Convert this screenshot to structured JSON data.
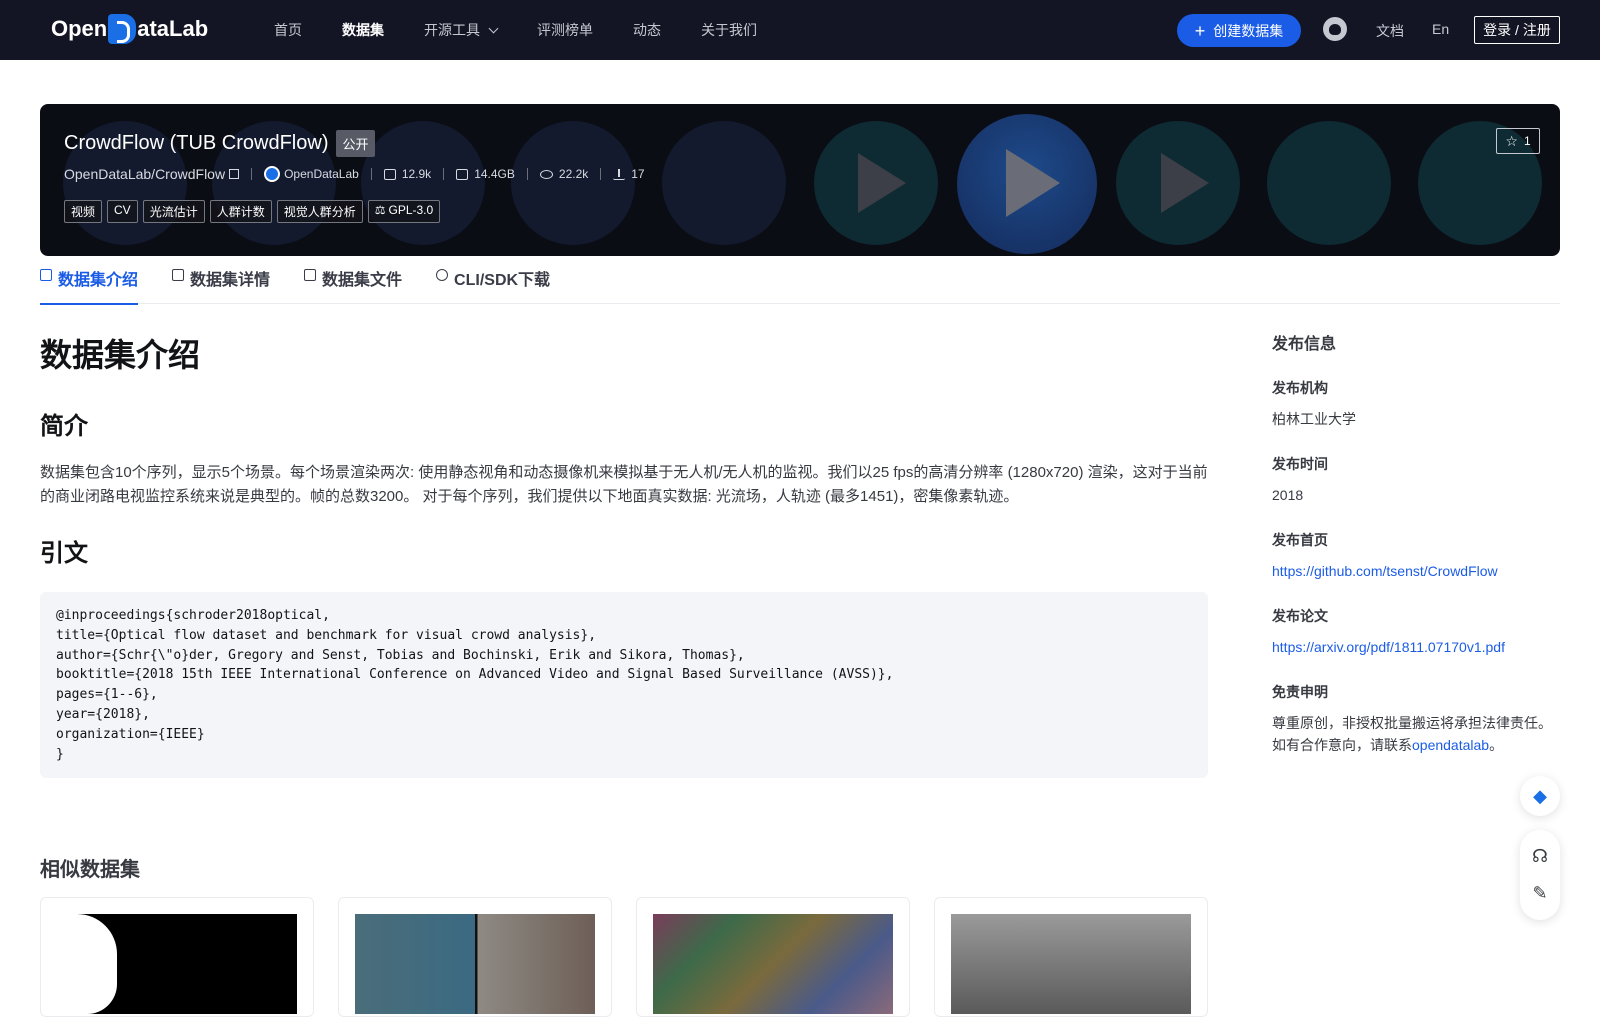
{
  "nav": {
    "logo": {
      "left": "Open",
      "right": "ataLab"
    },
    "links": [
      "首页",
      "数据集",
      "开源工具",
      "评测榜单",
      "动态",
      "关于我们"
    ],
    "active_link": "数据集",
    "create_label": "创建数据集",
    "docs_label": "文档",
    "lang_label": "En",
    "login_label": "登录 / 注册"
  },
  "hero": {
    "title": "CrowdFlow (TUB CrowdFlow)",
    "visibility": "公开",
    "path": "OpenDataLab/CrowdFlow",
    "org": "OpenDataLab",
    "stats": {
      "files": "12.9k",
      "size": "14.4GB",
      "views": "22.2k",
      "downloads": "17"
    },
    "tags": [
      "视频",
      "CV",
      "光流估计",
      "人群计数",
      "视觉人群分析"
    ],
    "license": "GPL-3.0",
    "star_count": "1"
  },
  "tabs": [
    {
      "label": "数据集介绍",
      "icon": "database-icon",
      "active": true
    },
    {
      "label": "数据集详情",
      "icon": "list-icon",
      "active": false
    },
    {
      "label": "数据集文件",
      "icon": "file-icon",
      "active": false
    },
    {
      "label": "CLI/SDK下载",
      "icon": "cloud-download-icon",
      "active": false
    }
  ],
  "main": {
    "heading": "数据集介绍",
    "intro_heading": "简介",
    "intro_text": "数据集包含10个序列，显示5个场景。每个场景渲染两次: 使用静态视角和动态摄像机来模拟基于无人机/无人机的监视。我们以25 fps的高清分辨率 (1280x720) 渲染，这对于当前的商业闭路电视监控系统来说是典型的。帧的总数3200。 对于每个序列，我们提供以下地面真实数据: 光流场，人轨迹 (最多1451)，密集像素轨迹。",
    "citation_heading": "引文",
    "citation": "@inproceedings{schroder2018optical,\ntitle={Optical flow dataset and benchmark for visual crowd analysis},\nauthor={Schr{\\\"o}der, Gregory and Senst, Tobias and Bochinski, Erik and Sikora, Thomas},\nbooktitle={2018 15th IEEE International Conference on Advanced Video and Signal Based Surveillance (AVSS)},\npages={1--6},\nyear={2018},\norganization={IEEE}\n}"
  },
  "similar": {
    "heading": "相似数据集"
  },
  "sidebar": {
    "title": "发布信息",
    "org_label": "发布机构",
    "org_value": "柏林工业大学",
    "time_label": "发布时间",
    "time_value": "2018",
    "home_label": "发布首页",
    "home_value": "https://github.com/tsenst/CrowdFlow",
    "paper_label": "发布论文",
    "paper_value": "https://arxiv.org/pdf/1811.07170v1.pdf",
    "disclaimer_label": "免责申明",
    "disclaimer_line1": "尊重原创，非授权批量搬运将承担法律责任。",
    "disclaimer_line2_prefix": "如有合作意向，请联系",
    "disclaimer_link": "opendatalab",
    "disclaimer_suffix": "。"
  },
  "colors": {
    "nav_bg": "#131524",
    "accent": "#1b5ce6",
    "hero_bg": "#0b0d14"
  }
}
